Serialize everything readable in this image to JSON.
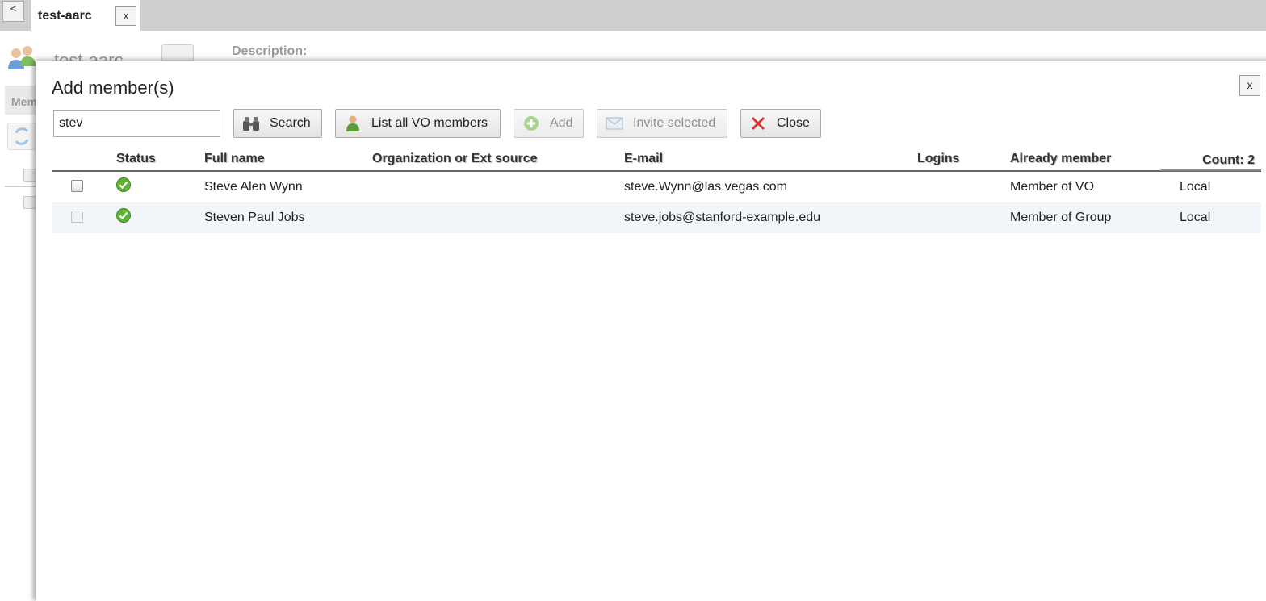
{
  "tabbar": {
    "back_label": "<",
    "active_tab": {
      "title": "test-aarc",
      "close_label": "x"
    }
  },
  "background_page": {
    "title": "test-aarc",
    "description_label": "Description:",
    "tab_label": "Mem"
  },
  "dialog": {
    "title": "Add member(s)",
    "close_label": "x",
    "search": {
      "value": "stev",
      "placeholder": ""
    },
    "buttons": {
      "search": "Search",
      "list_all": "List all VO members",
      "add": "Add",
      "invite": "Invite selected",
      "close": "Close"
    },
    "table": {
      "columns": {
        "status": "Status",
        "full_name": "Full name",
        "organization": "Organization or Ext source",
        "email": "E-mail",
        "logins": "Logins",
        "already_member": "Already member"
      },
      "count": "Count: 2",
      "rows": [
        {
          "status": "ok",
          "full_name": "Steve Alen Wynn",
          "organization": "",
          "email": "steve.Wynn@las.vegas.com",
          "logins": "",
          "already_member": "Member of VO",
          "source": "Local"
        },
        {
          "status": "ok",
          "full_name": "Steven Paul Jobs",
          "organization": "",
          "email": "steve.jobs@stanford-example.edu",
          "logins": "",
          "already_member": "Member of Group",
          "source": "Local"
        }
      ]
    }
  },
  "colors": {
    "status_ok": "#5fb336",
    "close_red": "#d9322f",
    "tabbar_bg": "#cfcfcf",
    "row_alt_bg": "#f2f5f9"
  },
  "icons": [
    "binoculars-icon",
    "user-icon",
    "add-circle-icon",
    "envelope-icon",
    "close-x-icon",
    "status-ok-icon",
    "group-icon",
    "refresh-icon",
    "edit-icon"
  ]
}
